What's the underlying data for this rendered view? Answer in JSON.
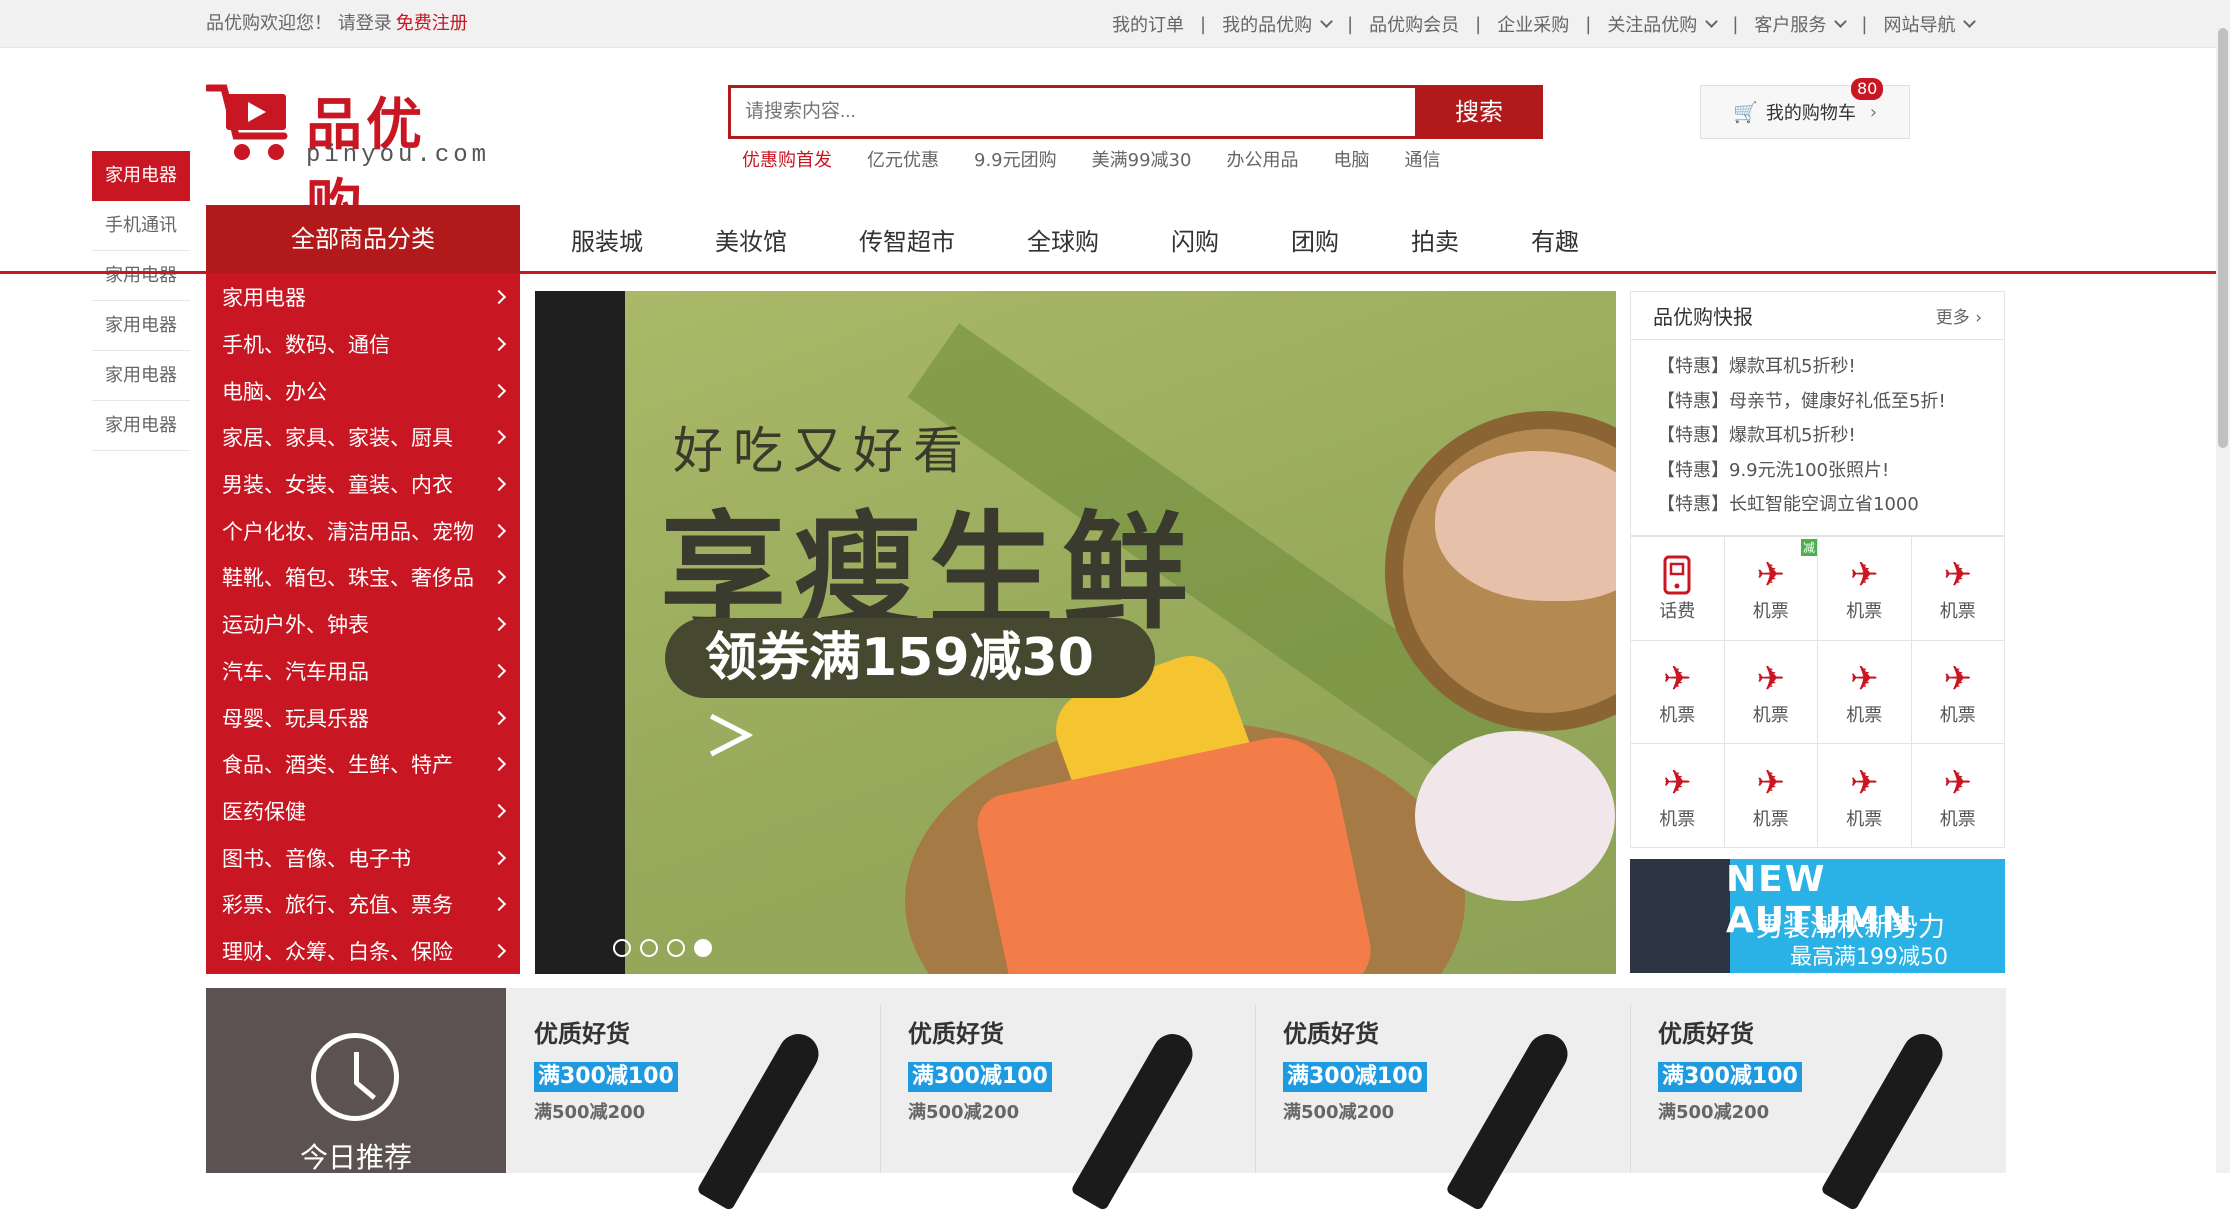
{
  "topbar": {
    "welcome": "品优购欢迎您！ 请登录",
    "register": "免费注册",
    "links": [
      "我的订单",
      "我的品优购",
      "品优购会员",
      "企业采购",
      "关注品优购",
      "客户服务",
      "网站导航"
    ]
  },
  "logo": {
    "name": "品优购",
    "domain": "pinyou.com"
  },
  "search": {
    "placeholder": "请搜索内容...",
    "button": "搜索"
  },
  "hotwords": [
    "优惠购首发",
    "亿元优惠",
    "9.9元团购",
    "美满99减30",
    "办公用品",
    "电脑",
    "通信"
  ],
  "cart": {
    "label": "我的购物车",
    "count": "80"
  },
  "sidenav": [
    "家用电器",
    "手机通讯",
    "家用电器",
    "家用电器",
    "家用电器",
    "家用电器"
  ],
  "nav": {
    "category_header": "全部商品分类",
    "items": [
      "服装城",
      "美妆馆",
      "传智超市",
      "全球购",
      "闪购",
      "团购",
      "拍卖",
      "有趣"
    ]
  },
  "categories": [
    "家用电器",
    "手机、数码、通信",
    "电脑、办公",
    "家居、家具、家装、厨具",
    "男装、女装、童装、内衣",
    "个户化妆、清洁用品、宠物",
    "鞋靴、箱包、珠宝、奢侈品",
    "运动户外、钟表",
    "汽车、汽车用品",
    "母婴、玩具乐器",
    "食品、酒类、生鲜、特产",
    "医药保健",
    "图书、音像、电子书",
    "彩票、旅行、充值、票务",
    "理财、众筹、白条、保险"
  ],
  "banner": {
    "line1": "好吃又好看",
    "line2": "享瘦生鲜",
    "coupon": "领券满159减30 ＞"
  },
  "news": {
    "title": "品优购快报",
    "more": "更多",
    "items": [
      "【特惠】爆款耳机5折秒!",
      "【特惠】母亲节，健康好礼低至5折!",
      "【特惠】爆款耳机5折秒!",
      "【特惠】9.9元洗100张照片!",
      "【特惠】长虹智能空调立省1000"
    ]
  },
  "services": [
    "话费",
    "机票",
    "机票",
    "机票",
    "机票",
    "机票",
    "机票",
    "机票",
    "机票",
    "机票",
    "机票",
    "机票"
  ],
  "service_tag": "减",
  "ad": {
    "line1": "NEW AUTUMN",
    "line2": "男装潮秋新势力",
    "line3": "最高满199减50"
  },
  "today": {
    "label": "今日推荐"
  },
  "products": [
    {
      "title": "优质好货",
      "badge": "满300减100",
      "sub": "满500减200"
    },
    {
      "title": "优质好货",
      "badge": "满300减100",
      "sub": "满500减200"
    },
    {
      "title": "优质好货",
      "badge": "满300减100",
      "sub": "满500减200"
    },
    {
      "title": "优质好货",
      "badge": "满300减100",
      "sub": "满500减200"
    }
  ],
  "colors": {
    "brand_red": "#c81623",
    "dark_red": "#b1191a",
    "ad_blue": "#2ab2e6",
    "promo_blue": "#1e9be0"
  }
}
